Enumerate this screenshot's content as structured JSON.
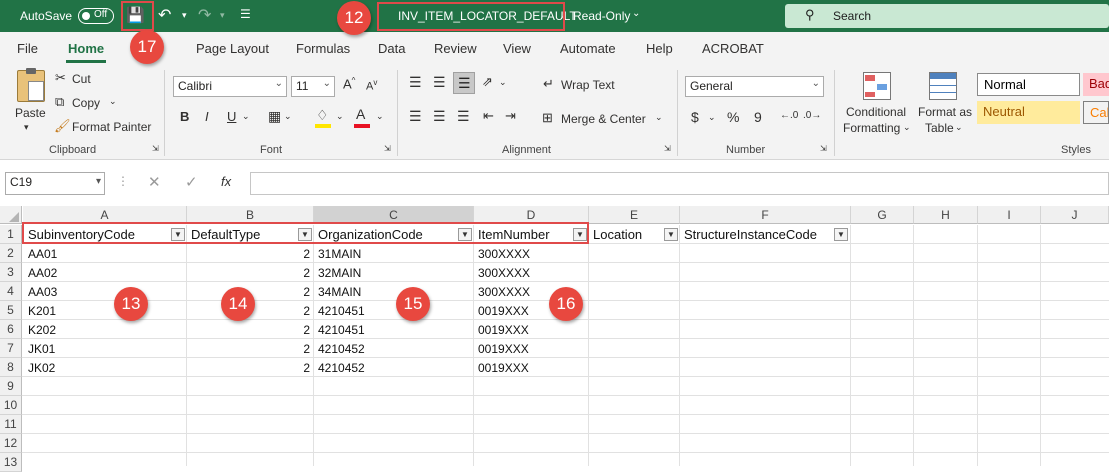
{
  "titlebar": {
    "autosave_label": "AutoSave",
    "autosave_state": "Off",
    "filename": "INV_ITEM_LOCATOR_DEFAULT",
    "separator": "-",
    "mode": "Read-Only",
    "search_placeholder": "Search"
  },
  "menu": {
    "tabs": [
      "File",
      "Home",
      "Page Layout",
      "Formulas",
      "Data",
      "Review",
      "View",
      "Automate",
      "Help",
      "ACROBAT"
    ],
    "active": "Home"
  },
  "ribbon": {
    "clipboard": {
      "paste": "Paste",
      "cut": "Cut",
      "copy": "Copy",
      "format_painter": "Format Painter",
      "label": "Clipboard"
    },
    "font": {
      "name": "Calibri",
      "size": "11",
      "bold": "B",
      "italic": "I",
      "underline": "U",
      "label": "Font"
    },
    "alignment": {
      "wrap_text": "Wrap Text",
      "merge_center": "Merge & Center",
      "label": "Alignment"
    },
    "number": {
      "format": "General",
      "currency": "$",
      "percent": "%",
      "comma": "9",
      "label": "Number"
    },
    "styles": {
      "conditional": "Conditional",
      "formatting": "Formatting",
      "format_as": "Format as",
      "table": "Table",
      "normal": "Normal",
      "bad": "Bad",
      "neutral": "Neutral",
      "calc": "Calc",
      "label": "Styles"
    }
  },
  "formula_bar": {
    "name_box": "C19",
    "fx": "fx",
    "value": ""
  },
  "grid": {
    "columns": [
      "A",
      "B",
      "C",
      "D",
      "E",
      "F",
      "G",
      "H",
      "I",
      "J"
    ],
    "selected_column": "C",
    "rows": [
      "1",
      "2",
      "3",
      "4",
      "5",
      "6",
      "7",
      "8",
      "9",
      "10",
      "11",
      "12",
      "13"
    ],
    "headers": [
      "SubinventoryCode",
      "DefaultType",
      "OrganizationCode",
      "ItemNumber",
      "Location",
      "StructureInstanceCode"
    ],
    "data": [
      [
        "AA01",
        "2",
        "31MAIN",
        "300XXXX"
      ],
      [
        "AA02",
        "2",
        "32MAIN",
        "300XXXX"
      ],
      [
        "AA03",
        "2",
        "34MAIN",
        "300XXXX"
      ],
      [
        "K201",
        "2",
        "4210451",
        "0019XXX"
      ],
      [
        "K202",
        "2",
        "4210451",
        "0019XXX"
      ],
      [
        "JK01",
        "2",
        "4210452",
        "0019XXX"
      ],
      [
        "JK02",
        "2",
        "4210452",
        "0019XXX"
      ]
    ]
  },
  "annotations": [
    "12",
    "13",
    "14",
    "15",
    "16",
    "17"
  ],
  "colors": {
    "excel_green": "#217346",
    "annotation_red": "#e8483f"
  }
}
